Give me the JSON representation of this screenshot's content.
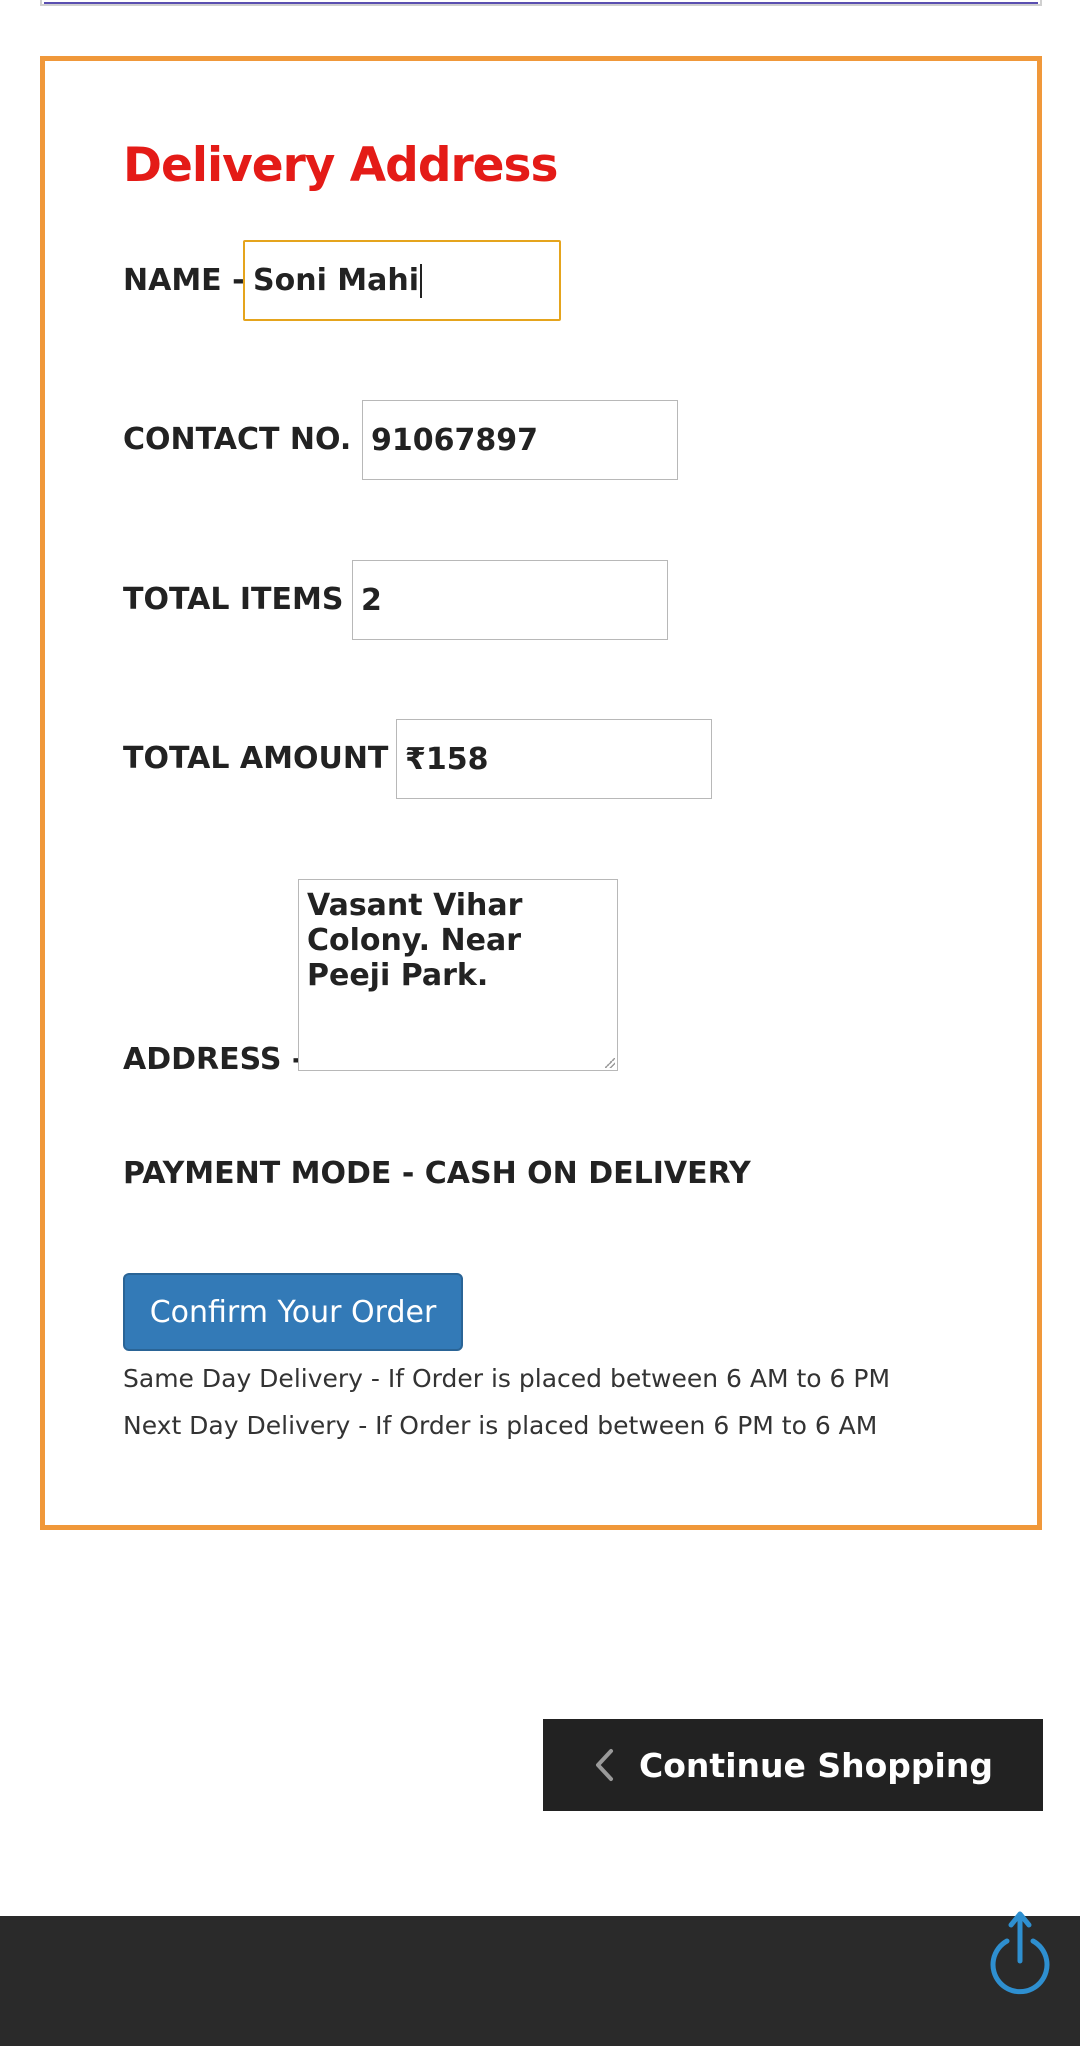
{
  "form": {
    "title": "Delivery Address",
    "name_label": "NAME -",
    "name_value": "Soni Mahi",
    "contact_label": "CONTACT NO. -",
    "contact_value": "91067897",
    "items_label": "TOTAL ITEMS -",
    "items_value": "2",
    "amount_label": "TOTAL AMOUNT -",
    "amount_value": "₹158",
    "address_label": "ADDRESS -",
    "address_value": "Vasant Vihar Colony. Near Peeji Park.",
    "payment_mode": "PAYMENT MODE - CASH ON DELIVERY",
    "confirm_label": "Confirm Your Order",
    "note_same_day": "Same Day Delivery - If Order is placed between 6 AM to 6 PM",
    "note_next_day": "Next Day Delivery - If Order is placed between 6 PM to 6 AM"
  },
  "actions": {
    "continue_label": "Continue Shopping"
  },
  "icons": {
    "continue": "chevron-left-icon",
    "scroll_top": "power-arrow-up-icon"
  },
  "colors": {
    "card_border": "#f0983a",
    "title": "#e41b17",
    "confirm_button": "#337ab7",
    "focus_border": "#e5a41d",
    "footer": "#2a2a2a",
    "scroll_icon": "#2e8fd0"
  }
}
